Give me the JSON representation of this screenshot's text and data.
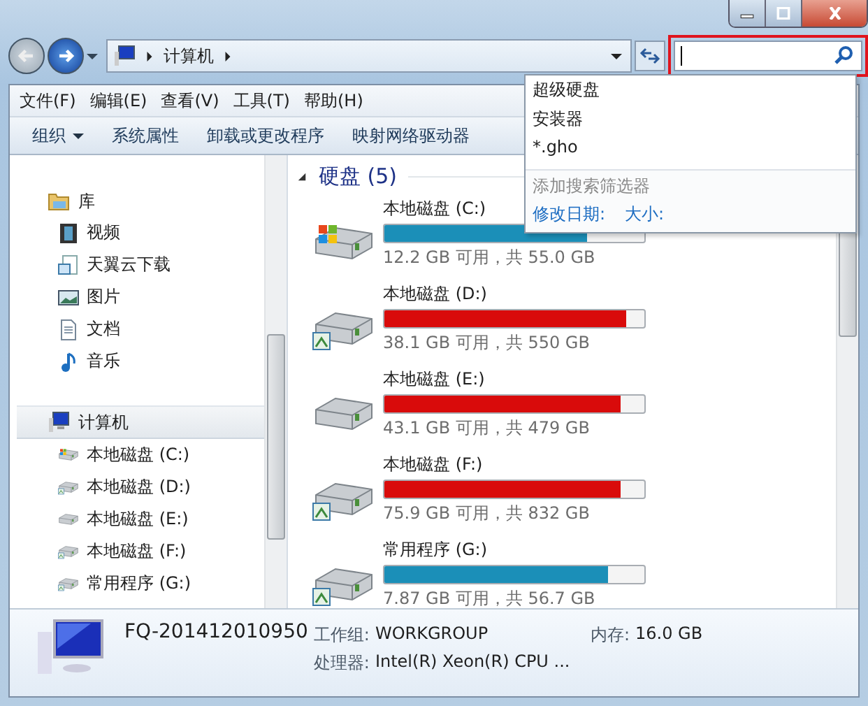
{
  "address": {
    "crumbs": [
      "计算机"
    ]
  },
  "search": {
    "highlighted": true
  },
  "search_suggestions": {
    "items": [
      "超级硬盘",
      "安装器",
      "*.gho"
    ],
    "filter_hint": "添加搜索筛选器",
    "filters": [
      "修改日期:",
      "大小:"
    ]
  },
  "menu": [
    "文件(F)",
    "编辑(E)",
    "查看(V)",
    "工具(T)",
    "帮助(H)"
  ],
  "toolbar": [
    {
      "label": "组织",
      "dropdown": true
    },
    {
      "label": "系统属性",
      "dropdown": false
    },
    {
      "label": "卸载或更改程序",
      "dropdown": false
    },
    {
      "label": "映射网络驱动器",
      "dropdown": false
    }
  ],
  "sidebar": {
    "groups": [
      {
        "label": "库",
        "kind": "library",
        "selected": false,
        "children": [
          {
            "label": "视频",
            "kind": "video",
            "selected": false
          },
          {
            "label": "天翼云下载",
            "kind": "download",
            "selected": false
          },
          {
            "label": "图片",
            "kind": "picture",
            "selected": false
          },
          {
            "label": "文档",
            "kind": "document",
            "selected": false
          },
          {
            "label": "音乐",
            "kind": "music",
            "selected": false
          }
        ]
      },
      {
        "label": "计算机",
        "kind": "computer",
        "selected": true,
        "children": [
          {
            "label": "本地磁盘 (C:)",
            "kind": "system",
            "selected": false
          },
          {
            "label": "本地磁盘 (D:)",
            "kind": "shared",
            "selected": false
          },
          {
            "label": "本地磁盘 (E:)",
            "kind": "drive",
            "selected": false
          },
          {
            "label": "本地磁盘 (F:)",
            "kind": "shared",
            "selected": false
          },
          {
            "label": "常用程序 (G:)",
            "kind": "shared",
            "selected": false
          }
        ]
      }
    ]
  },
  "section": {
    "title": "硬盘 (5)",
    "expanded": true
  },
  "drives": [
    {
      "name": "本地磁盘 (C:)",
      "kind": "system",
      "level": 0.78,
      "color": "#1b8fb8",
      "usage": "12.2 GB 可用，共 55.0 GB"
    },
    {
      "name": "本地磁盘 (D:)",
      "kind": "shared",
      "level": 0.93,
      "color": "#d90b0b",
      "usage": "38.1 GB 可用，共 550 GB"
    },
    {
      "name": "本地磁盘 (E:)",
      "kind": "drive",
      "level": 0.91,
      "color": "#d90b0b",
      "usage": "43.1 GB 可用，共 479 GB"
    },
    {
      "name": "本地磁盘 (F:)",
      "kind": "shared",
      "level": 0.91,
      "color": "#d90b0b",
      "usage": "75.9 GB 可用，共 832 GB"
    },
    {
      "name": "常用程序 (G:)",
      "kind": "shared",
      "level": 0.86,
      "color": "#1b8fb8",
      "usage": "7.87 GB 可用，共 56.7 GB"
    }
  ],
  "details": {
    "computer_name": "FQ-201412010950",
    "fields": [
      {
        "label": "工作组:",
        "value": "WORKGROUP"
      },
      {
        "label": "内存:",
        "value": "16.0 GB"
      },
      {
        "label": "处理器:",
        "value": "Intel(R) Xeon(R) CPU ..."
      }
    ]
  }
}
